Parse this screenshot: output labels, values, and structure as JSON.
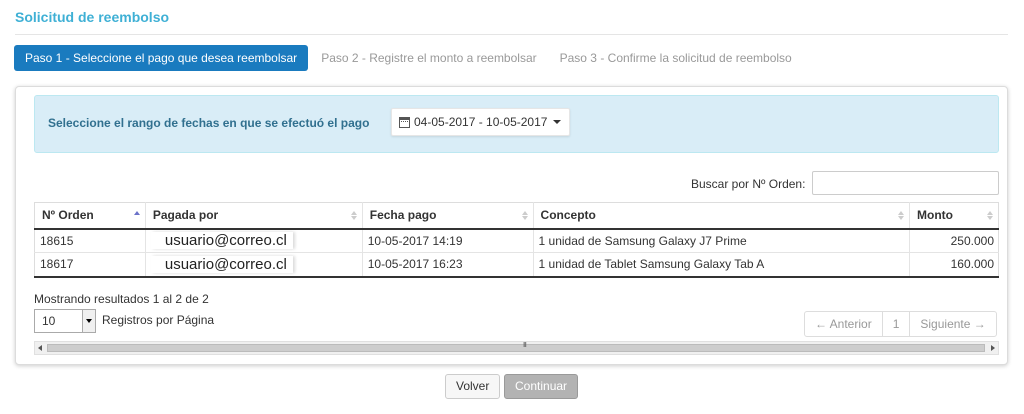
{
  "page": {
    "title": "Solicitud de reembolso"
  },
  "steps": [
    {
      "label": "Paso 1 - Seleccione el pago que desea reembolsar",
      "active": true
    },
    {
      "label": "Paso 2 - Registre el monto a reembolsar",
      "active": false
    },
    {
      "label": "Paso 3 - Confirme la solicitud de reembolso",
      "active": false
    }
  ],
  "date_filter": {
    "label": "Seleccione el rango de fechas en que se efectuó el pago",
    "range": "04-05-2017 - 10-05-2017"
  },
  "search": {
    "label": "Buscar por Nº Orden:",
    "value": ""
  },
  "table": {
    "columns": [
      "Nº Orden",
      "Pagada por",
      "Fecha pago",
      "Concepto",
      "Monto"
    ],
    "sorted_column": "Nº Orden",
    "rows": [
      {
        "orden": "18615",
        "pagada_por": "usuario@correo.cl",
        "fecha": "10-05-2017 14:19",
        "concepto": "1 unidad de Samsung Galaxy J7 Prime",
        "monto": "250.000"
      },
      {
        "orden": "18617",
        "pagada_por": "usuario@correo.cl",
        "fecha": "10-05-2017 16:23",
        "concepto": "1 unidad de Tablet Samsung Galaxy Tab A",
        "monto": "160.000"
      }
    ]
  },
  "footer": {
    "results_text": "Mostrando resultados 1 al 2 de 2",
    "per_page_value": "10",
    "per_page_label": "Registros por Página"
  },
  "pagination": {
    "prev": "← Anterior",
    "page": "1",
    "next": "Siguiente →"
  },
  "scrollbar": {
    "grip": "III"
  },
  "actions": {
    "back": "Volver",
    "continue": "Continuar"
  },
  "colors": {
    "title": "#3fb0d5",
    "step_active": "#1a7bbf",
    "info_bg": "#d9edf7",
    "info_text": "#31708f"
  }
}
